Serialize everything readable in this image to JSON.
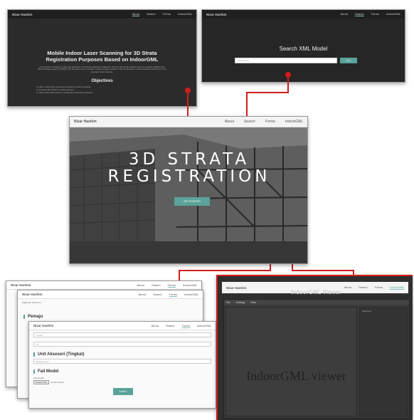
{
  "brand": "Nizar Hashim",
  "nav_links": [
    "About",
    "Search",
    "Forms",
    "IndoorGML"
  ],
  "about": {
    "title": "Mobile Indoor Laser Scanning for 3D Strata Registration Purposes Based on IndoorGML",
    "paragraph": "A new Project to develop a mobile web application for 3D strata registration in Malaysia. Currently data for 3D cadastre system is regularly updated by the National Mapping Agency (JUPEM). The 3D system may not be able to handle complex situations. Thus the 3D system could be extended into the form of the proposed indoor scanning.",
    "objectives_title": "Objectives",
    "objectives": [
      "To utilize mobile laser scanning technique for strata modelling.",
      "To generate 3D models for strata purposes.",
      "To utilize IndoorGML format for strata plan submission purposes."
    ]
  },
  "search": {
    "title": "Search XML Model",
    "placeholder": "UPI Number",
    "button": "Find"
  },
  "hero": {
    "line1": "3D STRATA",
    "line2": "REGISTRATION",
    "button": "GET STARTED"
  },
  "forms": {
    "form1_label": "Maklumat Pemohon",
    "pemaju": "Pemaju",
    "unit_title": "Unit Aksesori (Tingkat)",
    "unit_select": "Bilangan unit",
    "fail_title": "Fail Model",
    "indoorgml_label": "IndoorGML",
    "choose_file": "Choose File",
    "no_file": "No file chosen",
    "submit": "SUBMIT",
    "field_a": "Lokasi",
    "field_b": "P1"
  },
  "viewer": {
    "header": "IndoorGML Viewer",
    "menu": [
      "File",
      "Settings",
      "View"
    ],
    "caption": "IndoorGML viewer",
    "side_label": "Geometry"
  },
  "colors": {
    "accent": "#5aa39a",
    "connector": "#d11c1c"
  }
}
